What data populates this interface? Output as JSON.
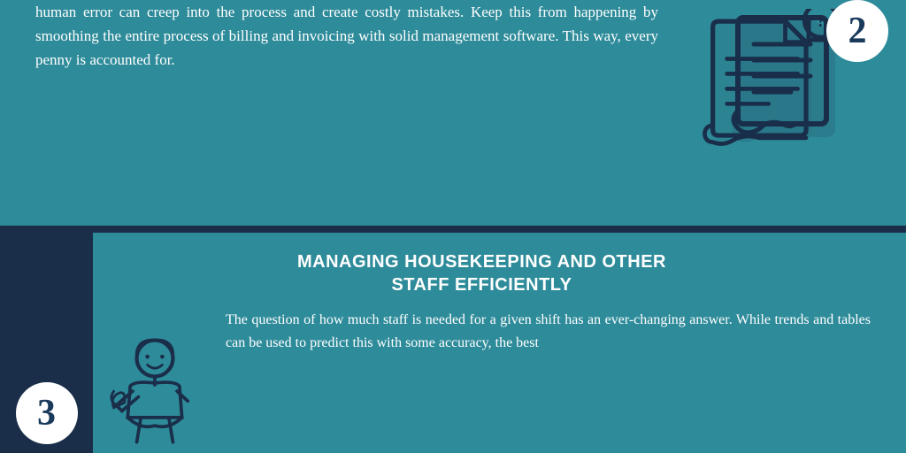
{
  "top": {
    "paragraph": "human error can creep into the process and create costly mistakes. Keep this from happening by smoothing the entire process of billing and invoicing with solid management software. This way, every penny is accounted for.",
    "badge2_label": "2"
  },
  "bottom": {
    "section_title_line1": "MANAGING HOUSEKEEPING AND OTHER",
    "section_title_line2": "STAFF EFFICIENTLY",
    "paragraph": "The question of how much staff is needed for a given shift has an ever-changing answer. While trends and tables can be used to predict this with some accuracy, the best",
    "badge3_label": "3"
  },
  "colors": {
    "teal": "#2e8b9a",
    "dark_navy": "#1a2e4a",
    "white": "#ffffff"
  }
}
